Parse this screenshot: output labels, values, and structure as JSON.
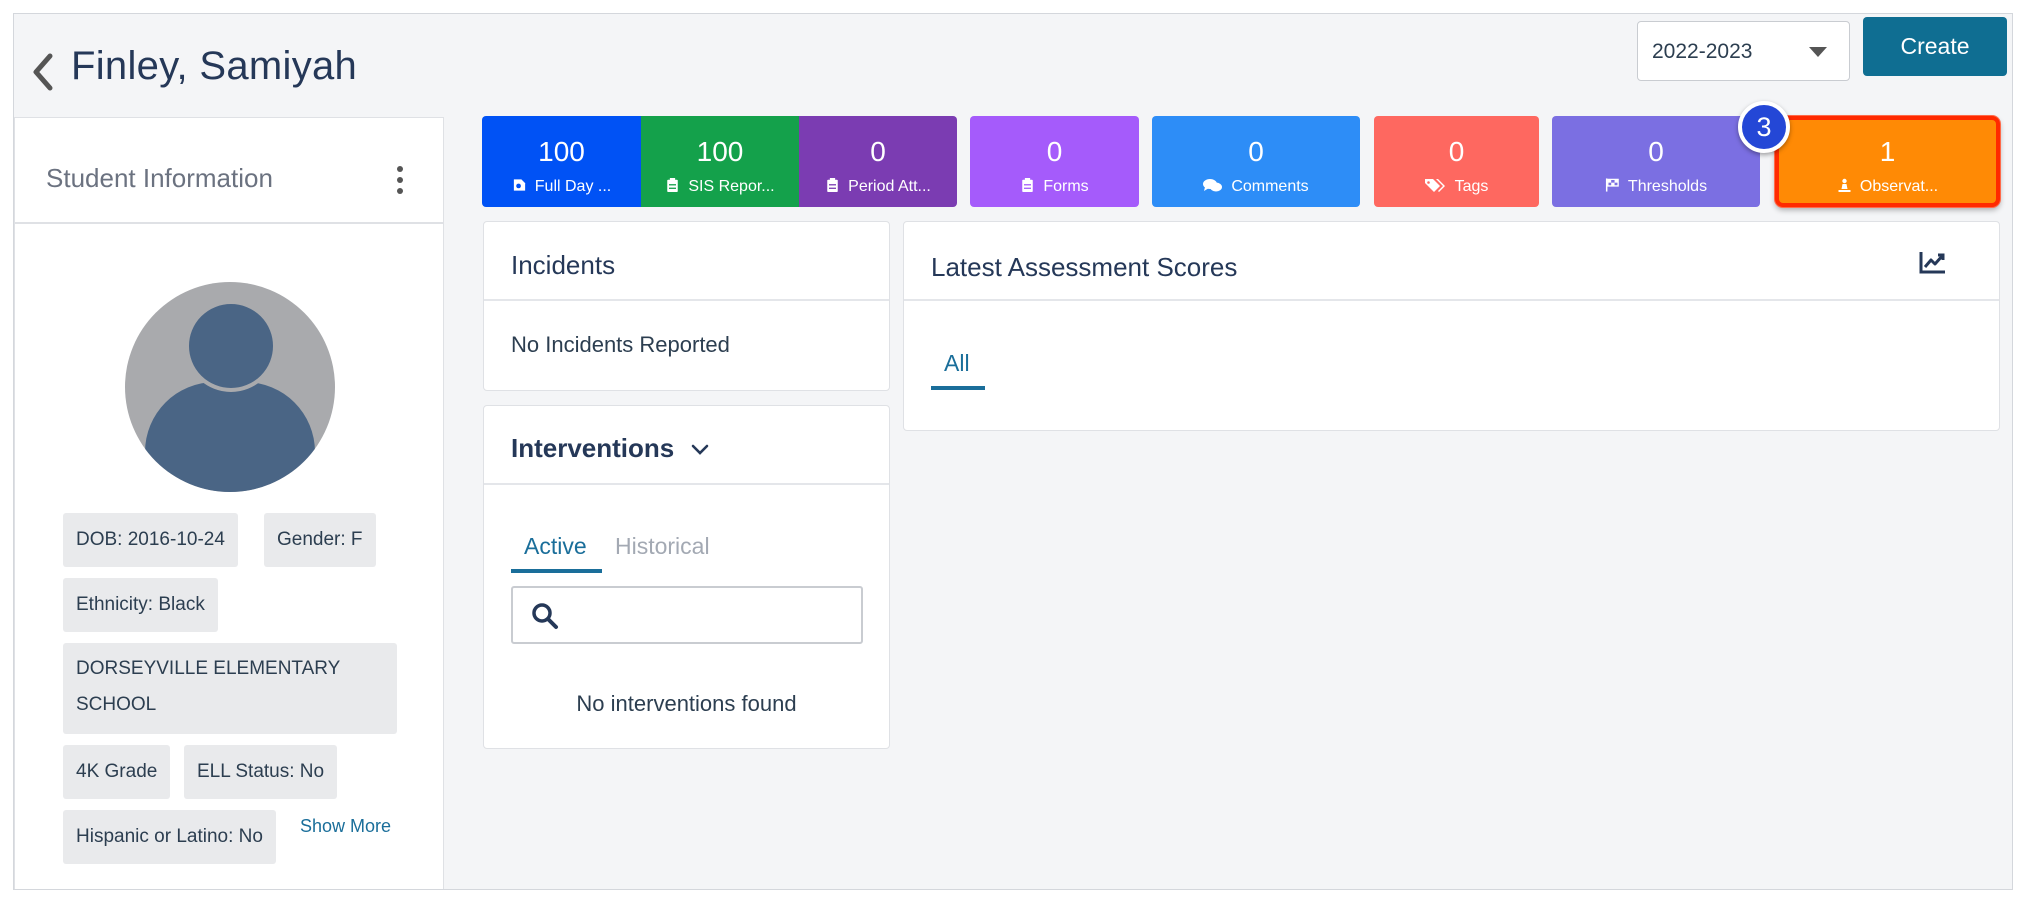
{
  "header": {
    "student_name": "Finley, Samiyah",
    "year": "2022-2023",
    "create_label": "Create"
  },
  "student_info": {
    "title": "Student Information",
    "dob": "DOB: 2016-10-24",
    "gender": "Gender: F",
    "ethnicity": "Ethnicity: Black",
    "school": "DORSEYVILLE ELEMENTARY SCHOOL",
    "grade": "4K Grade",
    "ell": "ELL Status: No",
    "hispanic": "Hispanic or Latino: No",
    "show_more": "Show More"
  },
  "tiles": [
    {
      "value": "100",
      "label": "Full Day ...",
      "color": "#0052f5",
      "icon": "attendance-icon"
    },
    {
      "value": "100",
      "label": "SIS Repor...",
      "color": "#14a14b",
      "icon": "clipboard-icon"
    },
    {
      "value": "0",
      "label": "Period Att...",
      "color": "#7b3cb2",
      "icon": "clipboard-icon"
    },
    {
      "value": "0",
      "label": "Forms",
      "color": "#a55bfb",
      "icon": "clipboard-icon"
    },
    {
      "value": "0",
      "label": "Comments",
      "color": "#2d8df7",
      "icon": "comments-icon"
    },
    {
      "value": "0",
      "label": "Tags",
      "color": "#fe6860",
      "icon": "tags-icon"
    },
    {
      "value": "0",
      "label": "Thresholds",
      "color": "#7b6fe2",
      "icon": "flag-icon"
    },
    {
      "value": "1",
      "label": "Observat...",
      "color": "#ff8a05",
      "icon": "observation-icon"
    }
  ],
  "step_badge": "3",
  "incidents": {
    "title": "Incidents",
    "empty": "No Incidents Reported"
  },
  "interventions": {
    "title": "Interventions",
    "tab_active": "Active",
    "tab_historical": "Historical",
    "search_value": "",
    "empty": "No interventions found"
  },
  "assessments": {
    "title": "Latest Assessment Scores",
    "tab_all": "All"
  },
  "colors": {
    "accent": "#1a6e9a",
    "create_button": "#0f6e92",
    "highlight": "#ff2a00"
  }
}
